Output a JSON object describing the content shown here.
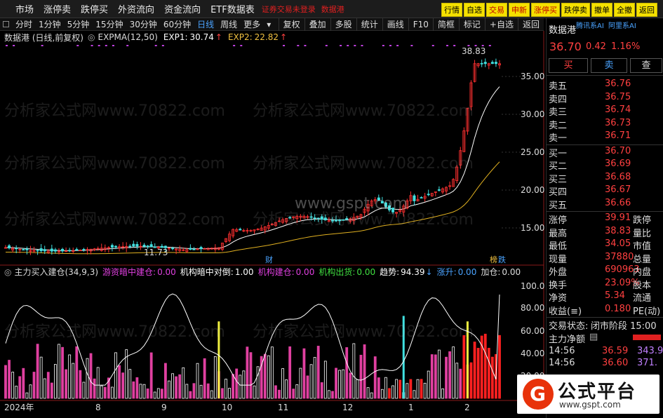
{
  "menu": {
    "items": [
      "市场",
      "涨停卖",
      "跌停买",
      "外资流向",
      "资金流向",
      "ETF数据表"
    ],
    "warn": "证券交易未登录",
    "warn2": "数据港"
  },
  "top_buttons": [
    "行情",
    "自选",
    "交易",
    "申新",
    "涨停买",
    "跌停卖",
    "撤单",
    "全撤",
    "返回"
  ],
  "toolbar": {
    "periods": [
      "分时",
      "1分钟",
      "5分钟",
      "15分钟",
      "30分钟",
      "60分钟",
      "日线",
      "周线",
      "更多"
    ],
    "selected": "日线",
    "right": [
      "复权",
      "叠加",
      "多股",
      "统计",
      "画线",
      "F10",
      "简框",
      "标记",
      "+自选",
      "返回"
    ]
  },
  "info": {
    "name": "数据港 (日线,前复权)",
    "ind": "EXPMA(12,50)",
    "exp1_label": "EXP1:",
    "exp1": "30.74",
    "exp2_label": "EXP2:",
    "exp2": "22.82"
  },
  "main_axis": [
    "35.00",
    "30.00",
    "25.00",
    "20.00",
    "15.00"
  ],
  "markers": {
    "high": "38.83",
    "low": "11.73",
    "cai": "财",
    "bang": "榜",
    "die": "跌"
  },
  "sub": {
    "title": "主力买入建仓(34,9,3)",
    "youzi_label": "游资暗中建仓:",
    "youzi": "0.00",
    "jigou_duidao_label": "机构暗中对倒:",
    "jigou_duidao": "1.00",
    "jigou_jc_label": "机构建仓:",
    "jigou_jc": "0.00",
    "jigou_ch_label": "机构出货:",
    "jigou_ch": "0.00",
    "qushi_label": "趋势:",
    "qushi": "94.39",
    "zhangsheng_label": "涨升:",
    "zhangsheng": "0.00",
    "jiacang_label": "加仓:",
    "jiacang": "0.00"
  },
  "sub_axis": [
    "100.0",
    "80.00",
    "60.00",
    "40.00",
    "20.00"
  ],
  "x_axis": [
    "2024年",
    "8",
    "9",
    "10",
    "11",
    "12",
    "1",
    "2"
  ],
  "right_panel": {
    "title": "数据港",
    "tag1": "腾讯系AI",
    "tag2": "阿里系AI",
    "price": "36.70",
    "change": "0.42",
    "pct": "1.16%",
    "buy": "买",
    "sell": "卖",
    "check": "查",
    "asks": [
      {
        "l": "卖五",
        "v": "36.76"
      },
      {
        "l": "卖四",
        "v": "36.75"
      },
      {
        "l": "卖三",
        "v": "36.74"
      },
      {
        "l": "卖二",
        "v": "36.73"
      },
      {
        "l": "卖一",
        "v": "36.71"
      }
    ],
    "bids": [
      {
        "l": "买一",
        "v": "36.70"
      },
      {
        "l": "买二",
        "v": "36.69"
      },
      {
        "l": "买三",
        "v": "36.68"
      },
      {
        "l": "买四",
        "v": "36.67"
      },
      {
        "l": "买五",
        "v": "36.66"
      }
    ],
    "stats": [
      {
        "l": "涨停",
        "v": "39.91",
        "l2": "跌停"
      },
      {
        "l": "最高",
        "v": "38.83",
        "l2": "量比"
      },
      {
        "l": "最低",
        "v": "34.05",
        "l2": "市值"
      },
      {
        "l": "现量",
        "v": "37880",
        "l2": "总量"
      },
      {
        "l": "外盘",
        "v": "690963",
        "l2": "内盘"
      },
      {
        "l": "换手",
        "v": "23.09%",
        "l2": "股本"
      },
      {
        "l": "净资",
        "v": "5.34",
        "l2": "流通"
      },
      {
        "l": "收益(≡)",
        "v": "0.180",
        "l2": "PE(动)"
      }
    ],
    "status_label": "交易状态:",
    "status": "闭市阶段 15:00",
    "net_label": "主力净额",
    "ticks": [
      {
        "t": "14:56",
        "p": "36.59",
        "v": "343.9"
      },
      {
        "t": "14:56",
        "p": "36.60",
        "v": "371."
      }
    ]
  },
  "logo": {
    "char": "G",
    "name": "公式平台",
    "url": "www.gspt.com"
  },
  "watermarks": [
    "分析家公式网www.70822.com",
    "www.gspt.com"
  ],
  "chart_data": {
    "type": "candlestick",
    "title": "数据港 (日线,前复权)",
    "x_ticks": [
      "2024年",
      "8",
      "9",
      "10",
      "11",
      "12",
      "1",
      "2"
    ],
    "y_ticks": [
      35,
      30,
      25,
      20,
      15
    ],
    "series": [
      {
        "name": "EXP1",
        "last": 30.74
      },
      {
        "name": "EXP2",
        "last": 22.82
      }
    ],
    "high": 38.83,
    "low": 11.73,
    "sub_y_ticks": [
      100,
      80,
      60,
      40,
      20
    ],
    "sub_trend_last": 94.39
  }
}
